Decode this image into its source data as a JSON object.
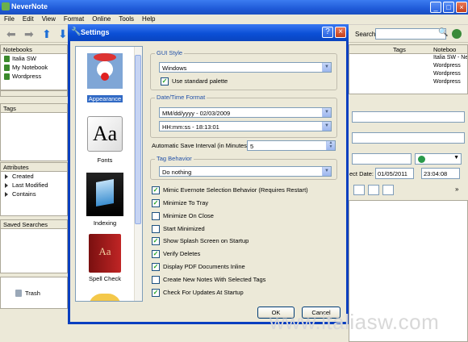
{
  "app": {
    "title": "NeverNote"
  },
  "menu": [
    "File",
    "Edit",
    "View",
    "Format",
    "Online",
    "Tools",
    "Help"
  ],
  "toolbar": {
    "search_label": "Search:",
    "search_value": ""
  },
  "left": {
    "notebooks_header": "Notebooks",
    "notebooks": [
      "Italia SW",
      "My Notebook",
      "Wordpress"
    ],
    "tags_header": "Tags",
    "attributes_header": "Attributes",
    "attributes": [
      "Created",
      "Last Modified",
      "Contains"
    ],
    "saved_searches_header": "Saved Searches",
    "trash": "Trash"
  },
  "right": {
    "tags_col": "Tags",
    "notebook_col": "Noteboo",
    "rows": [
      "Italia SW - Ne",
      "Wordpress",
      "Wordpress",
      "Wordpress"
    ],
    "subject_date_label": "ect Date:",
    "date_value": "01/05/2011",
    "time_value": "23:04:08"
  },
  "dialog": {
    "title": "Settings",
    "categories": [
      {
        "label": "Appearance",
        "icon": "clown-icon"
      },
      {
        "label": "Fonts",
        "icon": "font-aa-icon"
      },
      {
        "label": "Indexing",
        "icon": "indexing-icon"
      },
      {
        "label": "Spell Check",
        "icon": "spellcheck-book-icon"
      }
    ],
    "gui_style": {
      "label": "GUI Style",
      "value": "Windows",
      "standard_palette": "Use standard palette"
    },
    "datetime": {
      "label": "Date/Time Format",
      "date_value": "MM/dd/yyyy - 02/03/2009",
      "time_value": "HH:mm:ss - 18:13:01"
    },
    "autosave": {
      "label": "Automatic Save Interval (in Minutes)",
      "value": "5"
    },
    "tag_behavior": {
      "label": "Tag Behavior",
      "value": "Do nothing"
    },
    "options": [
      {
        "label": "Mimic Evernote Selection Behavior (Requires Restart)",
        "checked": true
      },
      {
        "label": "Minimize To Tray",
        "checked": true
      },
      {
        "label": "Minimize On Close",
        "checked": false
      },
      {
        "label": "Start Minimized",
        "checked": false
      },
      {
        "label": "Show Splash Screen on Startup",
        "checked": true
      },
      {
        "label": "Verify Deletes",
        "checked": true
      },
      {
        "label": "Display PDF Documents Inline",
        "checked": true
      },
      {
        "label": "Create New Notes With Selected Tags",
        "checked": false
      },
      {
        "label": "Check For Updates At Startup",
        "checked": true
      }
    ],
    "ok": "OK",
    "cancel": "Cancel"
  },
  "watermark": "www.italiasw.com"
}
